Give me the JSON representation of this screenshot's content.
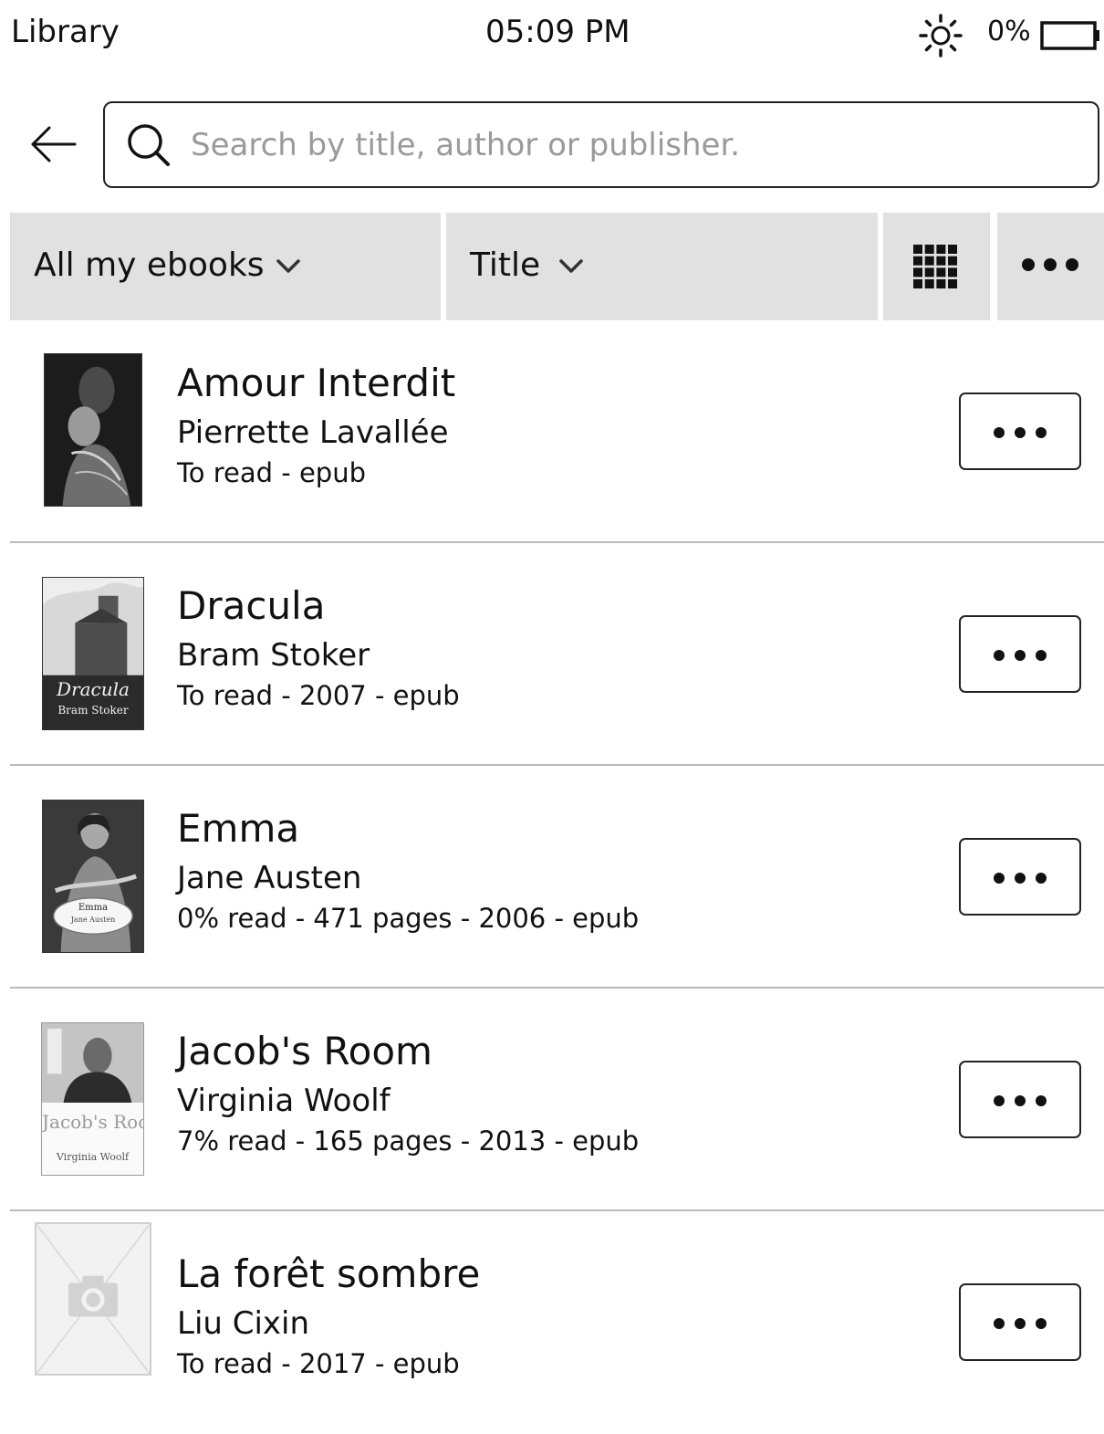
{
  "status_bar": {
    "app_title": "Library",
    "time": "05:09 PM",
    "battery_percent": "0%",
    "icons": [
      "brightness-icon",
      "battery-icon"
    ]
  },
  "search": {
    "placeholder": "Search by title, author or publisher.",
    "value": "",
    "icons": [
      "back-arrow-icon",
      "search-icon"
    ]
  },
  "toolbar": {
    "filter_label": "All my ebooks",
    "sort_label": "Title",
    "icons": [
      "chevron-down-icon",
      "grid-view-icon",
      "more-dots-icon"
    ]
  },
  "books": [
    {
      "title": "Amour Interdit",
      "author": "Pierrette Lavallée",
      "meta": "To read - epub",
      "cover": "amour-interdit-cover"
    },
    {
      "title": "Dracula",
      "author": "Bram Stoker",
      "meta": "To read - 2007 - epub",
      "cover": "dracula-cover",
      "cover_title": "Dracula",
      "cover_author": "Bram Stoker"
    },
    {
      "title": "Emma",
      "author": "Jane Austen",
      "meta": "0% read - 471 pages - 2006 - epub",
      "cover": "emma-cover",
      "cover_title": "Emma",
      "cover_author": "Jane Austen"
    },
    {
      "title": "Jacob's Room",
      "author": "Virginia Woolf",
      "meta": "7% read - 165 pages - 2013 - epub",
      "cover": "jacobs-room-cover",
      "cover_title": "Jacob's Room",
      "cover_author": "Virginia Woolf"
    },
    {
      "title": "La forêt sombre",
      "author": "Liu Cixin",
      "meta": "To read - 2017 - epub",
      "cover": "placeholder-camera-icon"
    }
  ]
}
